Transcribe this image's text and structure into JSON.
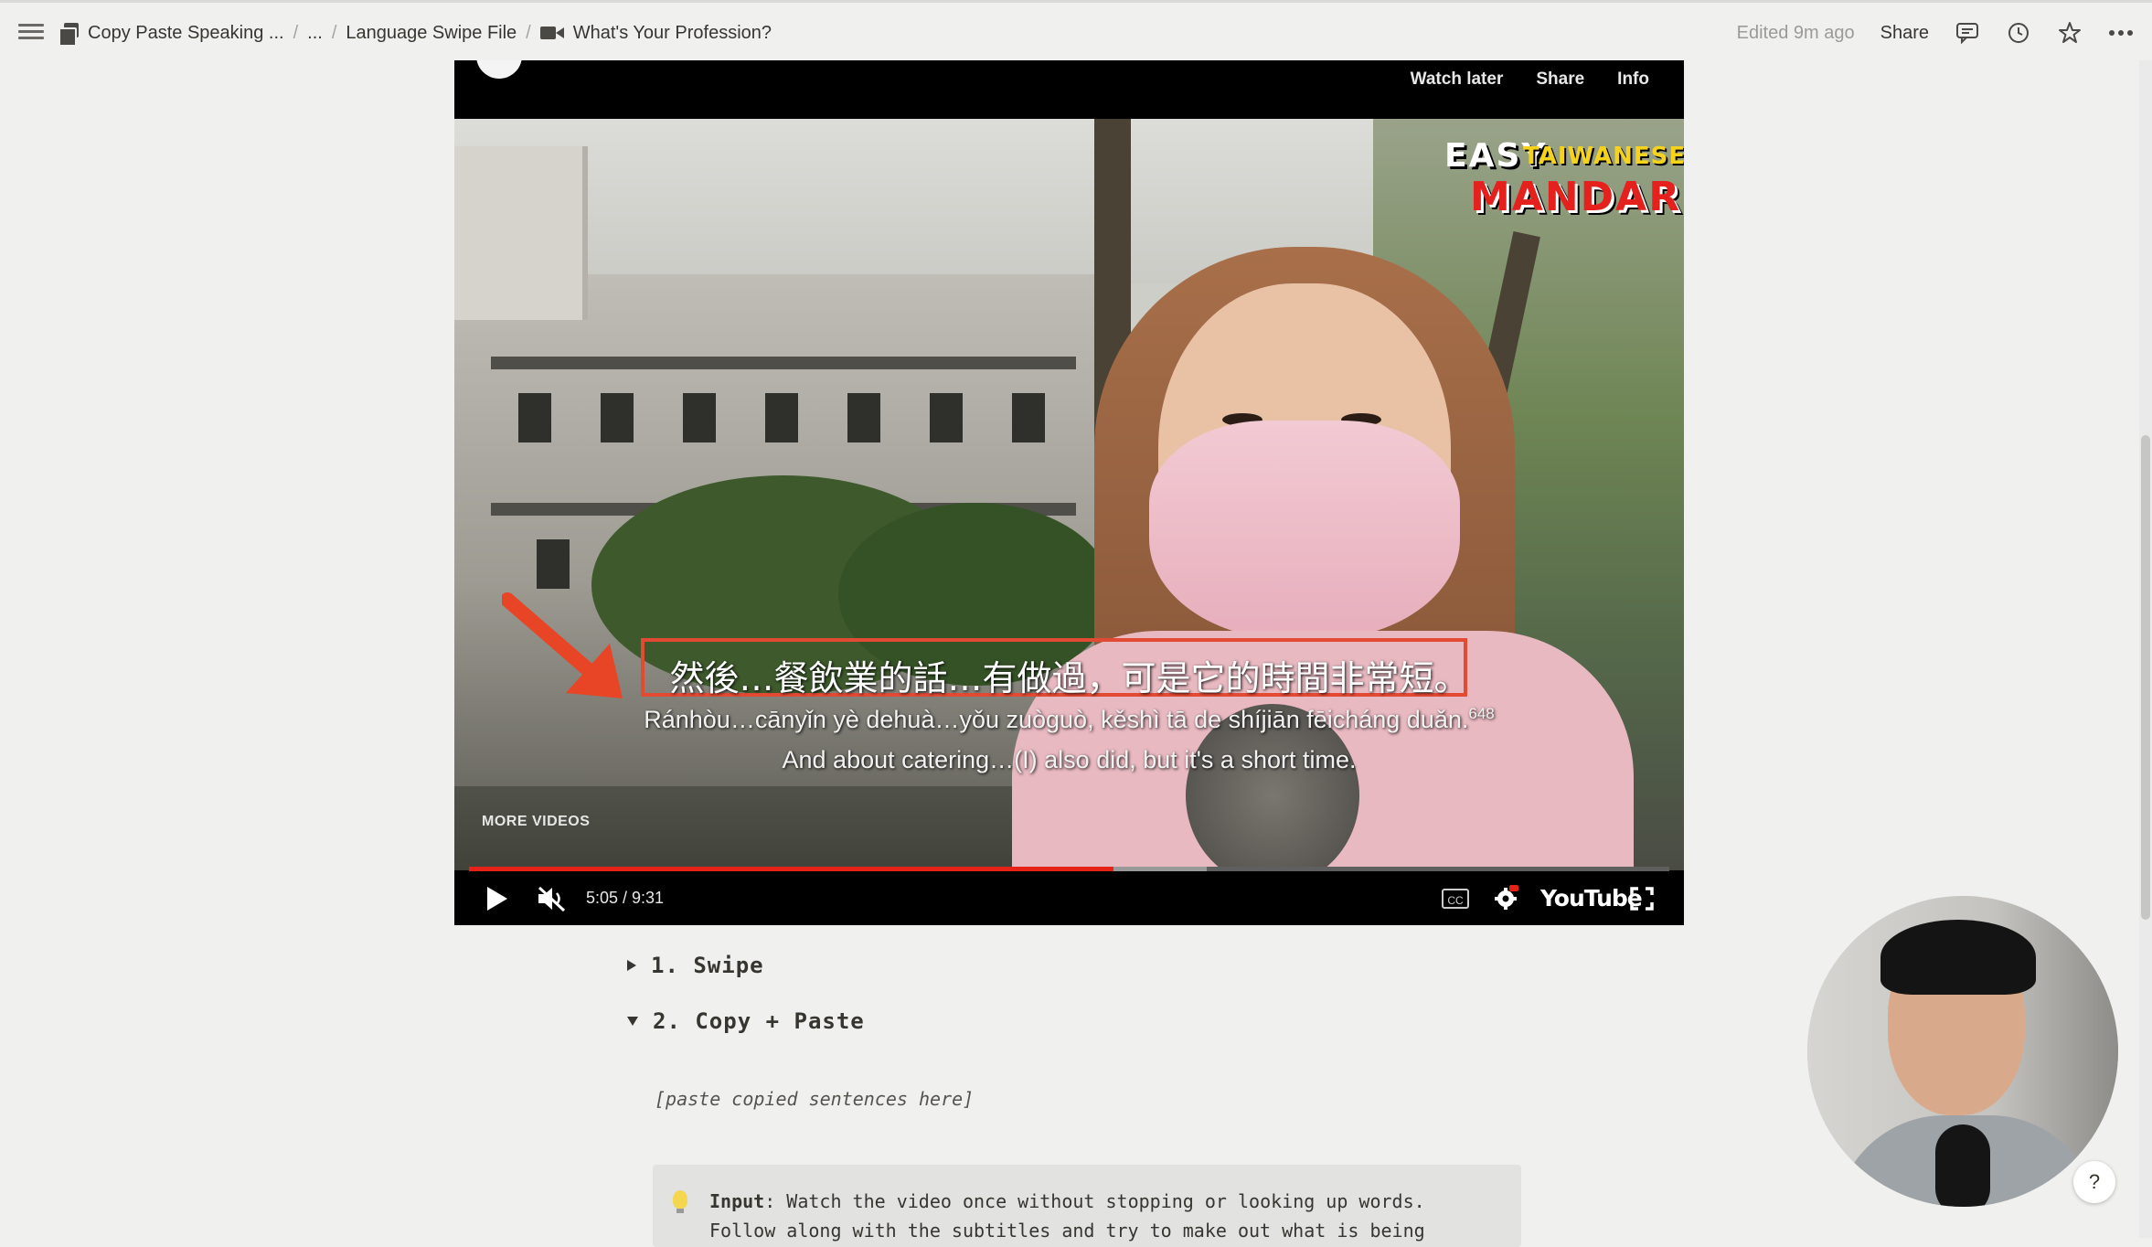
{
  "breadcrumb": {
    "items": [
      "Copy Paste Speaking ...",
      "...",
      "Language Swipe File",
      "What's Your Profession?"
    ],
    "separator": "/"
  },
  "topbar": {
    "edited": "Edited 9m ago",
    "share": "Share",
    "icons": [
      "comment-icon",
      "history-icon",
      "star-icon",
      "more-icon"
    ]
  },
  "video": {
    "top_links": [
      "Watch later",
      "Share",
      "Info"
    ],
    "brand": {
      "easy": "EASY",
      "taiwanese": "TAIWANESE",
      "mandarin": "MANDARIN"
    },
    "subtitle_zh": "然後…餐飲業的話…有做過，可是它的時間非常短。",
    "subtitle_pinyin": "Ránhòu…cānyǐn yè dehuà…yǒu zuòguò, kěshì tā de shíjiān fēicháng duǎn.",
    "subtitle_pinyin_counter": "648",
    "subtitle_en": "And about catering…(I) also did, but it's a short time.",
    "more_videos": "MORE VIDEOS",
    "time": "5:05 / 9:31",
    "played_fraction": 0.537,
    "buffered_fraction": 0.615,
    "cc_label": "CC",
    "youtube_label": "YouTube",
    "accent_color": "#e62117",
    "highlight_color": "#e24a34"
  },
  "toggles": [
    {
      "label": "1. Swipe",
      "expanded": false
    },
    {
      "label": "2. Copy + Paste",
      "expanded": true
    }
  ],
  "placeholder": "[paste copied sentences here]",
  "callout": {
    "title": "Input",
    "line1": ": Watch the video once without stopping or looking up words.",
    "line2": "Follow along with the subtitles and try to make out what is being"
  },
  "help": "?"
}
